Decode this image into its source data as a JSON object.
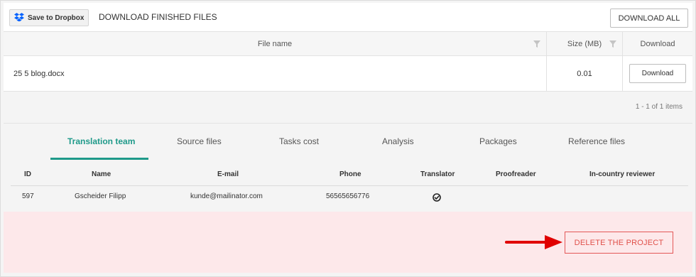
{
  "toolbar": {
    "dropbox_label": "Save to Dropbox",
    "dropbox_icon": "dropbox-icon",
    "title": "DOWNLOAD FINISHED FILES",
    "download_all_label": "DOWNLOAD ALL"
  },
  "files_grid": {
    "columns": [
      "File name",
      "Size (MB)",
      "Download"
    ],
    "rows": [
      {
        "file_name": "25 5 blog.docx",
        "size": "0.01",
        "action_label": "Download"
      }
    ],
    "pager_text": "1 - 1 of 1 items"
  },
  "tabs": [
    {
      "label": "Translation team",
      "active": true
    },
    {
      "label": "Source files",
      "active": false
    },
    {
      "label": "Tasks cost",
      "active": false
    },
    {
      "label": "Analysis",
      "active": false
    },
    {
      "label": "Packages",
      "active": false
    },
    {
      "label": "Reference files",
      "active": false
    }
  ],
  "team_table": {
    "columns": [
      "ID",
      "Name",
      "E-mail",
      "Phone",
      "Translator",
      "Proofreader",
      "In-country reviewer"
    ],
    "rows": [
      {
        "id": "597",
        "name": "Gscheider Filipp",
        "email": "kunde@mailinator.com",
        "phone": "56565656776",
        "translator_icon": "check-circle-icon"
      }
    ]
  },
  "danger_zone": {
    "delete_label": "DELETE THE PROJECT",
    "arrow_icon": "arrow-right-icon"
  },
  "colors": {
    "accent": "#1f9a8a",
    "danger": "#e0504a",
    "danger_bg": "#fde8ea",
    "dropbox_blue": "#0061fe",
    "arrow_red": "#e00000"
  }
}
